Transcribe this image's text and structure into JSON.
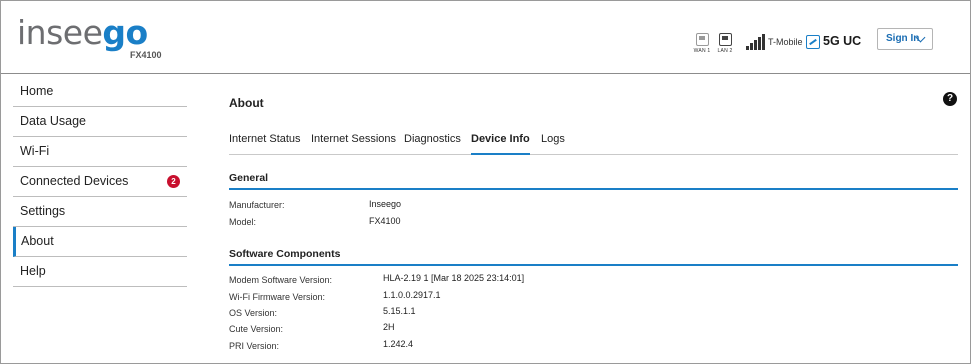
{
  "header": {
    "logo_part1": "insee",
    "logo_part2": "go",
    "model_sub": "FX4100",
    "wan_label": "WAN 1",
    "lan_label": "LAN 2",
    "carrier": "T-Mobile",
    "network_type": "5G UC",
    "signin_label": "Sign In",
    "accent_color": "#1a7fc7"
  },
  "sidebar": {
    "items": [
      {
        "label": "Home"
      },
      {
        "label": "Data Usage"
      },
      {
        "label": "Wi-Fi"
      },
      {
        "label": "Connected Devices",
        "badge": "2"
      },
      {
        "label": "Settings"
      },
      {
        "label": "About",
        "active": true
      },
      {
        "label": "Help"
      }
    ]
  },
  "main": {
    "title": "About",
    "help_icon": "?",
    "tabs": [
      {
        "label": "Internet Status"
      },
      {
        "label": "Internet Sessions"
      },
      {
        "label": "Diagnostics"
      },
      {
        "label": "Device Info",
        "active": true
      },
      {
        "label": "Logs"
      }
    ],
    "general": {
      "heading": "General",
      "rows": [
        {
          "label": "Manufacturer:",
          "value": "Inseego"
        },
        {
          "label": "Model:",
          "value": "FX4100"
        }
      ]
    },
    "software": {
      "heading": "Software Components",
      "rows": [
        {
          "label": "Modem Software Version:",
          "value": "HLA-2.19 1 [Mar 18 2025 23:14:01]"
        },
        {
          "label": "Wi-Fi Firmware Version:",
          "value": "1.1.0.0.2917.1"
        },
        {
          "label": "OS Version:",
          "value": "5.15.1.1"
        },
        {
          "label": "Cute Version:",
          "value": "2H"
        },
        {
          "label": "PRI Version:",
          "value": "1.242.4"
        }
      ]
    }
  }
}
